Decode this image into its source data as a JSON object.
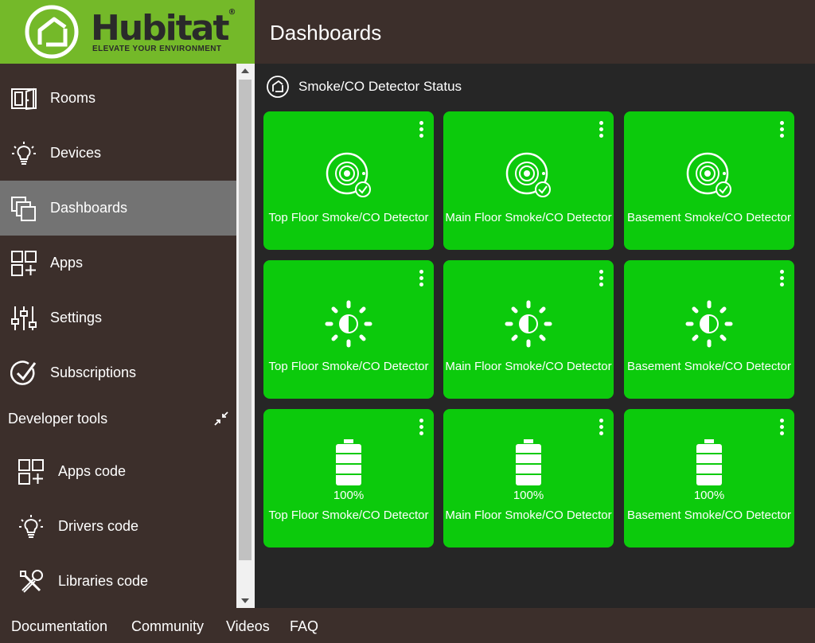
{
  "brand": {
    "name": "Hubitat",
    "registered": "®",
    "tagline": "ELEVATE YOUR ENVIRONMENT",
    "color": "#74b929"
  },
  "header": {
    "title": "Dashboards"
  },
  "sidebar": {
    "items": [
      {
        "label": "Rooms",
        "icon": "rooms-icon"
      },
      {
        "label": "Devices",
        "icon": "lightbulb-icon"
      },
      {
        "label": "Dashboards",
        "icon": "dashboards-icon",
        "active": true
      },
      {
        "label": "Apps",
        "icon": "apps-grid-icon"
      },
      {
        "label": "Settings",
        "icon": "sliders-icon"
      },
      {
        "label": "Subscriptions",
        "icon": "check-circle-icon"
      }
    ],
    "developer_tools": {
      "label": "Developer tools",
      "collapse_icon": "collapse-arrows-icon",
      "items": [
        {
          "label": "Apps code",
          "icon": "apps-grid-icon"
        },
        {
          "label": "Drivers code",
          "icon": "lightbulb-icon"
        },
        {
          "label": "Libraries code",
          "icon": "tools-icon"
        }
      ]
    },
    "active_color": "#737373"
  },
  "dashboard": {
    "title": "Smoke/CO Detector Status",
    "tile_color": "#0cca0c",
    "tiles": [
      {
        "label": "Top Floor Smoke/CO Detector",
        "icon": "smoke-detector-clear-icon"
      },
      {
        "label": "Main Floor Smoke/CO Detector",
        "icon": "smoke-detector-clear-icon"
      },
      {
        "label": "Basement Smoke/CO Detector",
        "icon": "smoke-detector-clear-icon"
      },
      {
        "label": "Top Floor Smoke/CO Detector",
        "icon": "tamper-sun-icon"
      },
      {
        "label": "Main Floor Smoke/CO Detector",
        "icon": "tamper-sun-icon"
      },
      {
        "label": "Basement Smoke/CO Detector",
        "icon": "tamper-sun-icon"
      },
      {
        "label": "Top Floor Smoke/CO Detector",
        "icon": "battery-full-icon",
        "value": "100%"
      },
      {
        "label": "Main Floor Smoke/CO Detector",
        "icon": "battery-full-icon",
        "value": "100%"
      },
      {
        "label": "Basement Smoke/CO Detector",
        "icon": "battery-full-icon",
        "value": "100%"
      }
    ]
  },
  "footer": {
    "links": [
      "Documentation",
      "Community",
      "Videos",
      "FAQ"
    ]
  }
}
